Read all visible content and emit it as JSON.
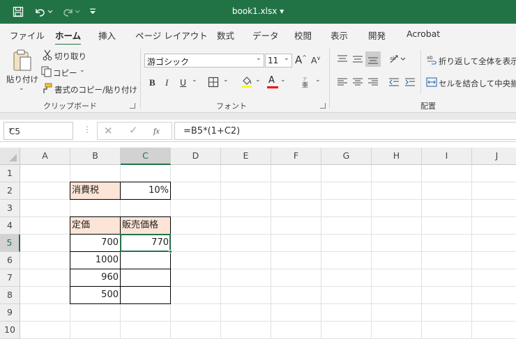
{
  "title": "book1.xlsx",
  "tabs": [
    {
      "label": "ファイル"
    },
    {
      "label": "ホーム"
    },
    {
      "label": "挿入"
    },
    {
      "label": "ページ レイアウト"
    },
    {
      "label": "数式"
    },
    {
      "label": "データ"
    },
    {
      "label": "校閲"
    },
    {
      "label": "表示"
    },
    {
      "label": "開発"
    },
    {
      "label": "Acrobat"
    }
  ],
  "ribbon": {
    "clipboard": {
      "paste": "貼り付け",
      "cut": "切り取り",
      "copy": "コピー",
      "format_painter": "書式のコピー/貼り付け",
      "group_label": "クリップボード"
    },
    "font": {
      "name": "游ゴシック",
      "size": "11",
      "bold": "B",
      "italic": "I",
      "underline": "U",
      "font_color": "A",
      "grow": "A",
      "shrink": "A",
      "group_label": "フォント"
    },
    "alignment": {
      "wrap_text": "折り返して全体を表示す",
      "merge_center": "セルを結合して中央揃え",
      "group_label": "配置"
    }
  },
  "formula_bar": {
    "name_box": "C5",
    "fx": "fx",
    "formula": "=B5*(1+C2)"
  },
  "columns": [
    "A",
    "B",
    "C",
    "D",
    "E",
    "F",
    "G",
    "H",
    "I",
    "J"
  ],
  "rows": [
    "1",
    "2",
    "3",
    "4",
    "5",
    "6",
    "7",
    "8",
    "9",
    "10"
  ],
  "cells": {
    "B2": "消費税",
    "C2": "10%",
    "B4": "定価",
    "C4": "販売価格",
    "B5": "700",
    "C5": "770",
    "B6": "1000",
    "B7": "960",
    "B8": "500"
  },
  "colors": {
    "accent": "#217346",
    "header_fill": "#fce4d6",
    "font_color_bar": "#ff0000"
  }
}
